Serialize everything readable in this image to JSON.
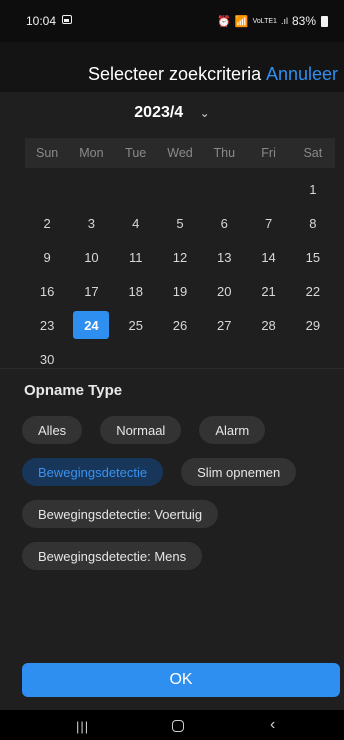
{
  "status": {
    "time": "10:04",
    "network": "VoLTE1",
    "battery": "83%",
    "icons": [
      "image-icon",
      "alarm-icon",
      "wifi-icon",
      "signal-icon",
      "battery-icon"
    ]
  },
  "header": {
    "title": "Selecteer zoekcriteria",
    "cancel_label": "Annuleer"
  },
  "calendar": {
    "month_label": "2023/4",
    "chevron": "⌄",
    "weekdays": [
      "Sun",
      "Mon",
      "Tue",
      "Wed",
      "Thu",
      "Fri",
      "Sat"
    ],
    "first_weekday_index": 6,
    "days": [
      "1",
      "2",
      "3",
      "4",
      "5",
      "6",
      "7",
      "8",
      "9",
      "10",
      "11",
      "12",
      "13",
      "14",
      "15",
      "16",
      "17",
      "18",
      "19",
      "20",
      "21",
      "22",
      "23",
      "24",
      "25",
      "26",
      "27",
      "28",
      "29",
      "30"
    ],
    "selected_day": "24"
  },
  "recording_type": {
    "title": "Opname Type",
    "options": [
      "Alles",
      "Normaal",
      "Alarm",
      "Bewegingsdetectie",
      "Slim opnemen",
      "Bewegingsdetectie: Voertuig",
      "Bewegingsdetectie: Mens"
    ],
    "selected": "Bewegingsdetectie"
  },
  "ok_label": "OK",
  "colors": {
    "accent": "#2f8ff0",
    "chip_selected_bg": "#17365a",
    "panel_bg": "#1f1f1f"
  },
  "nav": {
    "recent": "|||",
    "back": "‹"
  }
}
